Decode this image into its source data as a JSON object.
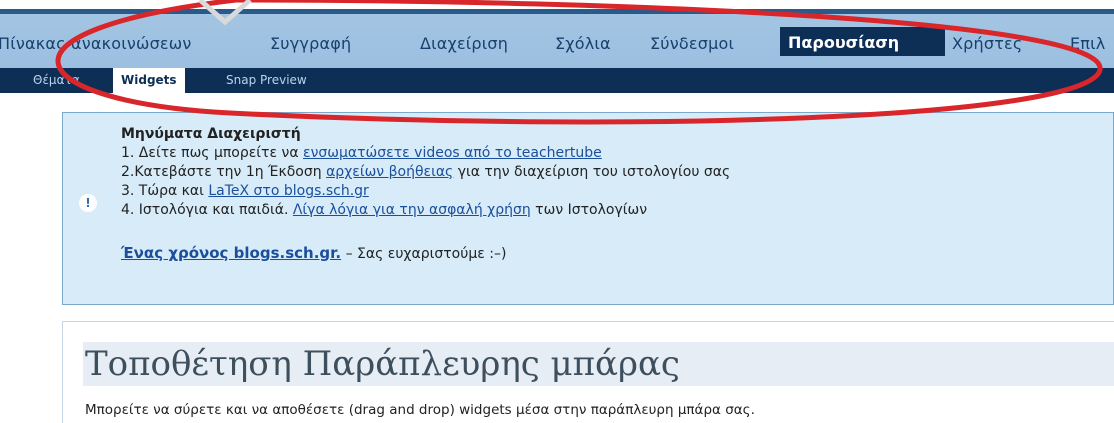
{
  "nav": {
    "items": [
      "Πίνακας ανακοινώσεων",
      "Συγγραφή",
      "Διαχείριση",
      "Σχόλια",
      "Σύνδεσμοι"
    ],
    "active": "Παρουσίαση",
    "after": [
      "Χρήστες",
      "Επιλ"
    ]
  },
  "subnav": {
    "first": "Θέματα",
    "active": "Widgets",
    "last": "Snap Preview"
  },
  "notice": {
    "icon": "!",
    "title": "Μηνύματα Διαχειριστή",
    "l1_pre": "1. Δείτε πως μπορείτε να ",
    "l1_link": "ενσωματώσετε videos από το teachertube",
    "l2_pre": "2.Κατεβάστε την 1η Έκδοση ",
    "l2_link": "αρχείων βοήθειας",
    "l2_post": " για την διαχείριση του ιστολογίου σας",
    "l3_pre": "3. Τώρα και ",
    "l3_link": "LaTeX στο blogs.sch.gr",
    "l4_pre": "4. Ιστολόγια και παιδιά. ",
    "l4_link": "Λίγα λόγια για την ασφαλή χρήση",
    "l4_post": " των Ιστολογίων",
    "l5_link": "Ένας χρόνος blogs.sch.gr.",
    "l5_post": " – Σας ευχαριστούμε :–)"
  },
  "content": {
    "heading": "Τοποθέτηση Παράπλευρης μπάρας",
    "desc": "Μπορείτε να σύρετε και να αποθέσετε (drag and drop) widgets μέσα στην παράπλευρη μπάρα σας."
  },
  "annotation_color": "#d8262b"
}
